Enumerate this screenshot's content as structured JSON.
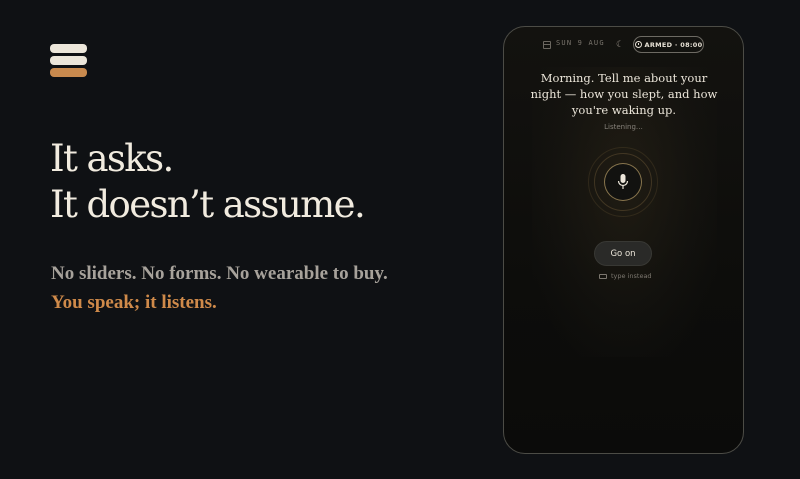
{
  "brand": {
    "logo_icon": "stack-logo-icon",
    "colors": {
      "light": "#ece6da",
      "accent": "#c98a4e"
    }
  },
  "hero": {
    "headline_line1": "It asks.",
    "headline_line2": "It doesn’t assume.",
    "subline1": "No sliders. No forms. No wearable to buy.",
    "subline2": "You speak; it listens."
  },
  "phone": {
    "status": {
      "calendar_icon": "calendar-icon",
      "date": "SUN 9 AUG",
      "moon_icon": "moon-icon",
      "alarm_icon": "alarm-clock-icon",
      "armed_label": "ARMED · 08:00"
    },
    "prompt": "Morning. Tell me about your night — how you slept, and how you're waking up.",
    "listening": "Listening…",
    "mic_icon": "microphone-icon",
    "go_on_label": "Go on",
    "keyboard_icon": "keyboard-icon",
    "type_instead_label": "type instead"
  }
}
